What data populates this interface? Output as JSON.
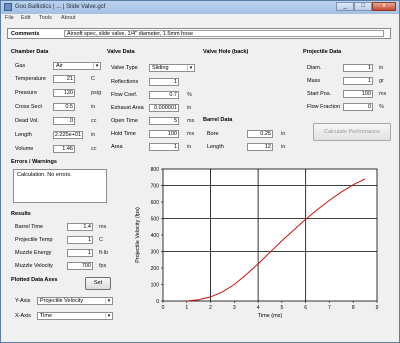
{
  "window": {
    "title": "Goo Ballistics | ... | Slide Valve.gcf",
    "min": "_",
    "max": "□",
    "close": "x"
  },
  "menubar": [
    "File",
    "Edit",
    "Tools",
    "About"
  ],
  "comments": {
    "label": "Comments",
    "value": "Airsoft spec, slide valve, 1/4\" diameter, 1.5mm hose"
  },
  "chamber": {
    "header": "Chamber Data",
    "rows": [
      {
        "label": "Gas",
        "value": "Air",
        "type": "select"
      },
      {
        "label": "Temperature",
        "value": "21",
        "unit": "C"
      },
      {
        "label": "Pressure",
        "value": "120",
        "unit": "psig"
      },
      {
        "label": "Cross Sect",
        "value": "0.5",
        "unit": "in"
      },
      {
        "label": "Dead Vol.",
        "value": "0",
        "unit": "cc"
      },
      {
        "label": "Length",
        "value": "2.225e+01",
        "unit": "in"
      },
      {
        "label": "Volume",
        "value": "1.46",
        "unit": "cc"
      }
    ]
  },
  "valve": {
    "header": "Valve Data",
    "rows": [
      {
        "label": "Valve Type",
        "value": "Sliding",
        "type": "select"
      },
      {
        "label": "Reflections",
        "value": "1"
      },
      {
        "label": "Flow Coef.",
        "value": "0.7",
        "unit": "%"
      },
      {
        "label": "Exhaust Area",
        "value": "0.000001",
        "unit": "in"
      },
      {
        "label": "Open Time",
        "value": "5",
        "unit": "ms"
      },
      {
        "label": "Hold Time",
        "value": "100",
        "unit": "ms"
      },
      {
        "label": "Area",
        "value": "1",
        "unit": "in"
      }
    ]
  },
  "valve_hole": {
    "header": "Valve Hole (back)",
    "bore_header": "Barrel Data",
    "rows": [
      {
        "label": "Bore",
        "value": "0.25",
        "unit": "in"
      },
      {
        "label": "Length",
        "value": "12",
        "unit": "in"
      }
    ]
  },
  "projectile": {
    "header": "Projectile Data",
    "rows": [
      {
        "label": "Diam.",
        "value": "1",
        "unit": "in"
      },
      {
        "label": "Mass",
        "value": "1",
        "unit": "gr"
      },
      {
        "label": "Start Pos.",
        "value": "100",
        "unit": "ms"
      },
      {
        "label": "Flow Fraction",
        "value": "0",
        "unit": "%"
      }
    ]
  },
  "calc_button": "Calculate Performance",
  "errors": {
    "header": "Errors / Warnings",
    "text": "Calculation. No errors."
  },
  "results": {
    "header": "Results",
    "rows": [
      {
        "label": "Barrel Time",
        "value": "1.4",
        "unit": "ms"
      },
      {
        "label": "Projectile Temp",
        "value": "1",
        "unit": "C"
      },
      {
        "label": "Muzzle Energy",
        "value": "1",
        "unit": "ft·lb"
      },
      {
        "label": "Muzzle Velocity",
        "value": "700",
        "unit": "fps"
      }
    ]
  },
  "plot_axes": {
    "header": "Plotted Data Axes",
    "set_button": "Set",
    "y_label": "Y-Axis",
    "y_value": "Projectile Velocity",
    "x_label": "X-Axis",
    "x_value": "Time"
  },
  "colors": {
    "curve": "#cc1111",
    "title_bg": "#a9c4e4"
  },
  "chart_data": {
    "type": "line",
    "xlabel": "Time (ms)",
    "ylabel": "Projectile Velocity (fps)",
    "xlim": [
      0,
      9
    ],
    "ylim": [
      0,
      800
    ],
    "x_ticks": [
      0,
      1,
      2,
      3,
      4,
      5,
      6,
      7,
      8,
      9
    ],
    "y_ticks": [
      0,
      100,
      200,
      300,
      400,
      500,
      600,
      700,
      800
    ],
    "grid": true,
    "series": [
      {
        "x": [
          1.0,
          1.5,
          2.0,
          2.5,
          3.0,
          3.5,
          4.0,
          4.5,
          5.0,
          5.5,
          6.0,
          6.5,
          7.0,
          7.5,
          8.0,
          8.5
        ],
        "values": [
          0,
          8,
          25,
          55,
          100,
          160,
          225,
          295,
          365,
          430,
          495,
          555,
          610,
          660,
          705,
          740
        ]
      }
    ]
  }
}
